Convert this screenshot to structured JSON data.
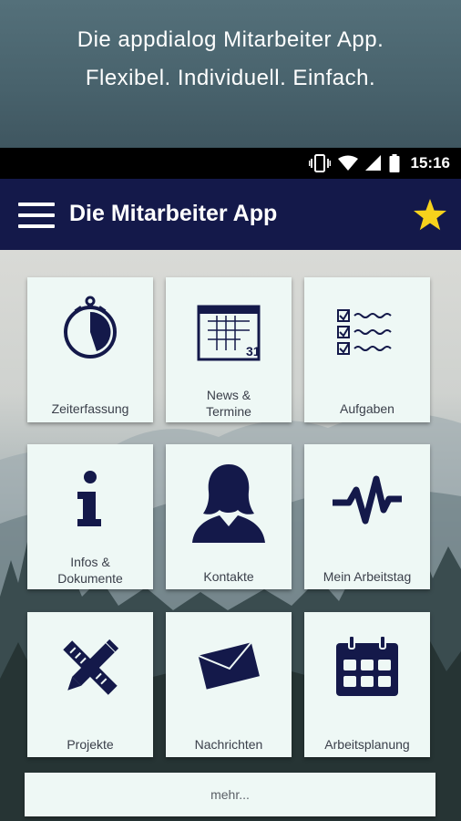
{
  "promo": {
    "line1": "Die appdialog Mitarbeiter App.",
    "line2": "Flexibel. Individuell. Einfach."
  },
  "status_bar": {
    "time": "15:16",
    "icons": [
      "vibrate-icon",
      "wifi-icon",
      "signal-icon",
      "battery-icon"
    ]
  },
  "app_bar": {
    "title": "Die Mitarbeiter App",
    "menu_icon": "hamburger-menu-icon",
    "favorite_icon": "star-icon",
    "background": "#14194a",
    "accent": "#f7d21c"
  },
  "tiles": [
    {
      "label": "Zeiterfassung",
      "icon": "stopwatch-icon"
    },
    {
      "label": "News & Termine",
      "label_line1": "News &",
      "label_line2": "Termine",
      "icon": "calendar-icon"
    },
    {
      "label": "Aufgaben",
      "icon": "checklist-icon"
    },
    {
      "label": "Infos & Dokumente",
      "label_line1": "Infos &",
      "label_line2": "Dokumente",
      "icon": "info-icon"
    },
    {
      "label": "Kontakte",
      "icon": "person-icon"
    },
    {
      "label": "Mein Arbeitstag",
      "icon": "pulse-icon"
    },
    {
      "label": "Projekte",
      "icon": "pencil-ruler-icon"
    },
    {
      "label": "Nachrichten",
      "icon": "envelope-icon"
    },
    {
      "label": "Arbeitsplanung",
      "icon": "planner-calendar-icon"
    }
  ],
  "more_button": {
    "label": "mehr..."
  },
  "colors": {
    "tile_background": "#eef8f5",
    "icon_color": "#14194a",
    "status_bar": "#000000"
  }
}
